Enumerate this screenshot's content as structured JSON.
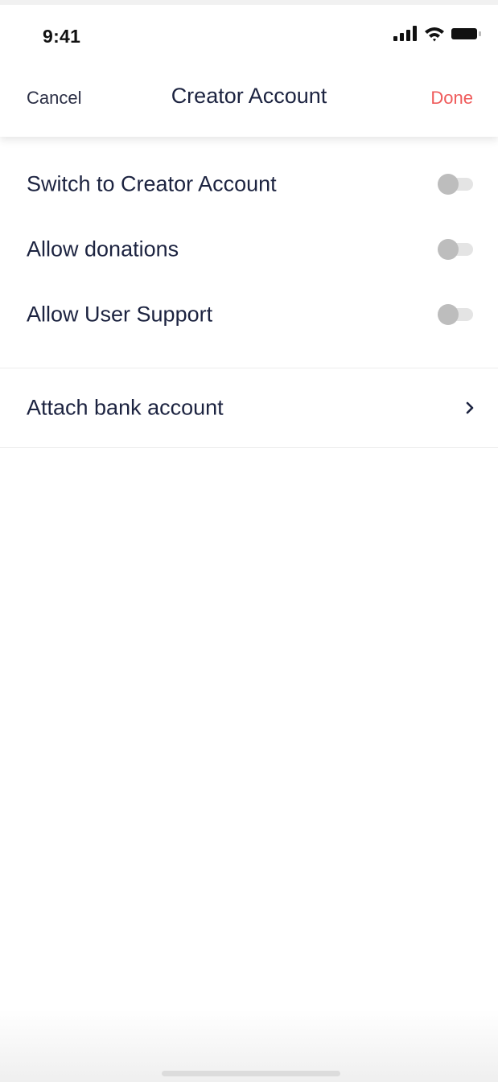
{
  "status_bar": {
    "time": "9:41",
    "icons": [
      "cellular-signal-icon",
      "wifi-icon",
      "battery-icon"
    ]
  },
  "nav": {
    "cancel_label": "Cancel",
    "title": "Creator Account",
    "done_label": "Done"
  },
  "settings": {
    "toggles": [
      {
        "label": "Switch to Creator Account",
        "enabled": false
      },
      {
        "label": "Allow donations",
        "enabled": false
      },
      {
        "label": "Allow User Support",
        "enabled": false
      }
    ],
    "links": [
      {
        "label": "Attach bank account",
        "icon": "chevron-right-icon"
      }
    ]
  },
  "colors": {
    "accent": "#ef5b5b",
    "text_primary": "#1c2340",
    "toggle_knob_off": "#bdbdbd",
    "toggle_track_off": "#e4e4e4"
  }
}
